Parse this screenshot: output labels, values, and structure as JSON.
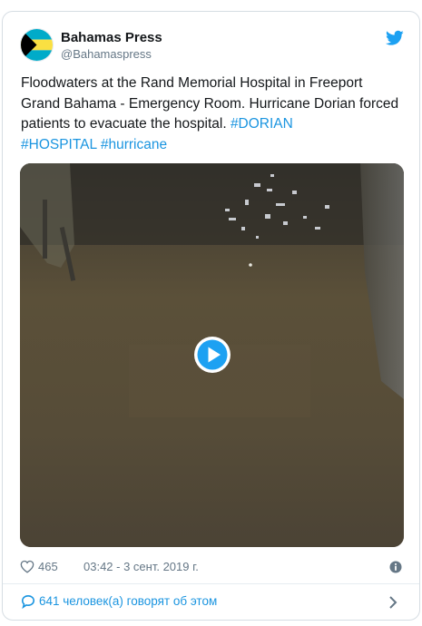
{
  "author": {
    "name": "Bahamas Press",
    "handle": "@Bahamaspress"
  },
  "tweet": {
    "text_plain": "Floodwaters at the Rand Memorial Hospital in Freeport Grand Bahama - Emergency Room. Hurricane Dorian forced patients to evacuate the hospital. ",
    "hashtags": [
      "#DORIAN",
      "#HOSPITAL",
      "#hurricane"
    ]
  },
  "media": {
    "type": "video",
    "play_icon": "play-icon"
  },
  "meta": {
    "likes": "465",
    "timestamp": "03:42 - 3 сент. 2019 г."
  },
  "footer": {
    "conversation": "641 человек(а) говорят об этом"
  },
  "colors": {
    "link": "#1b95e0",
    "secondary_text": "#657786",
    "primary_text": "#14171a",
    "border": "#d6dde3",
    "twitter_blue": "#1da1f2",
    "flag_aquamarine": "#00abc9",
    "flag_gold": "#fae042",
    "flag_black": "#000000"
  },
  "icons": [
    "bahamas-flag-avatar",
    "twitter-bird-icon",
    "play-icon",
    "heart-icon",
    "info-icon",
    "speech-bubble-icon",
    "chevron-right-icon"
  ]
}
